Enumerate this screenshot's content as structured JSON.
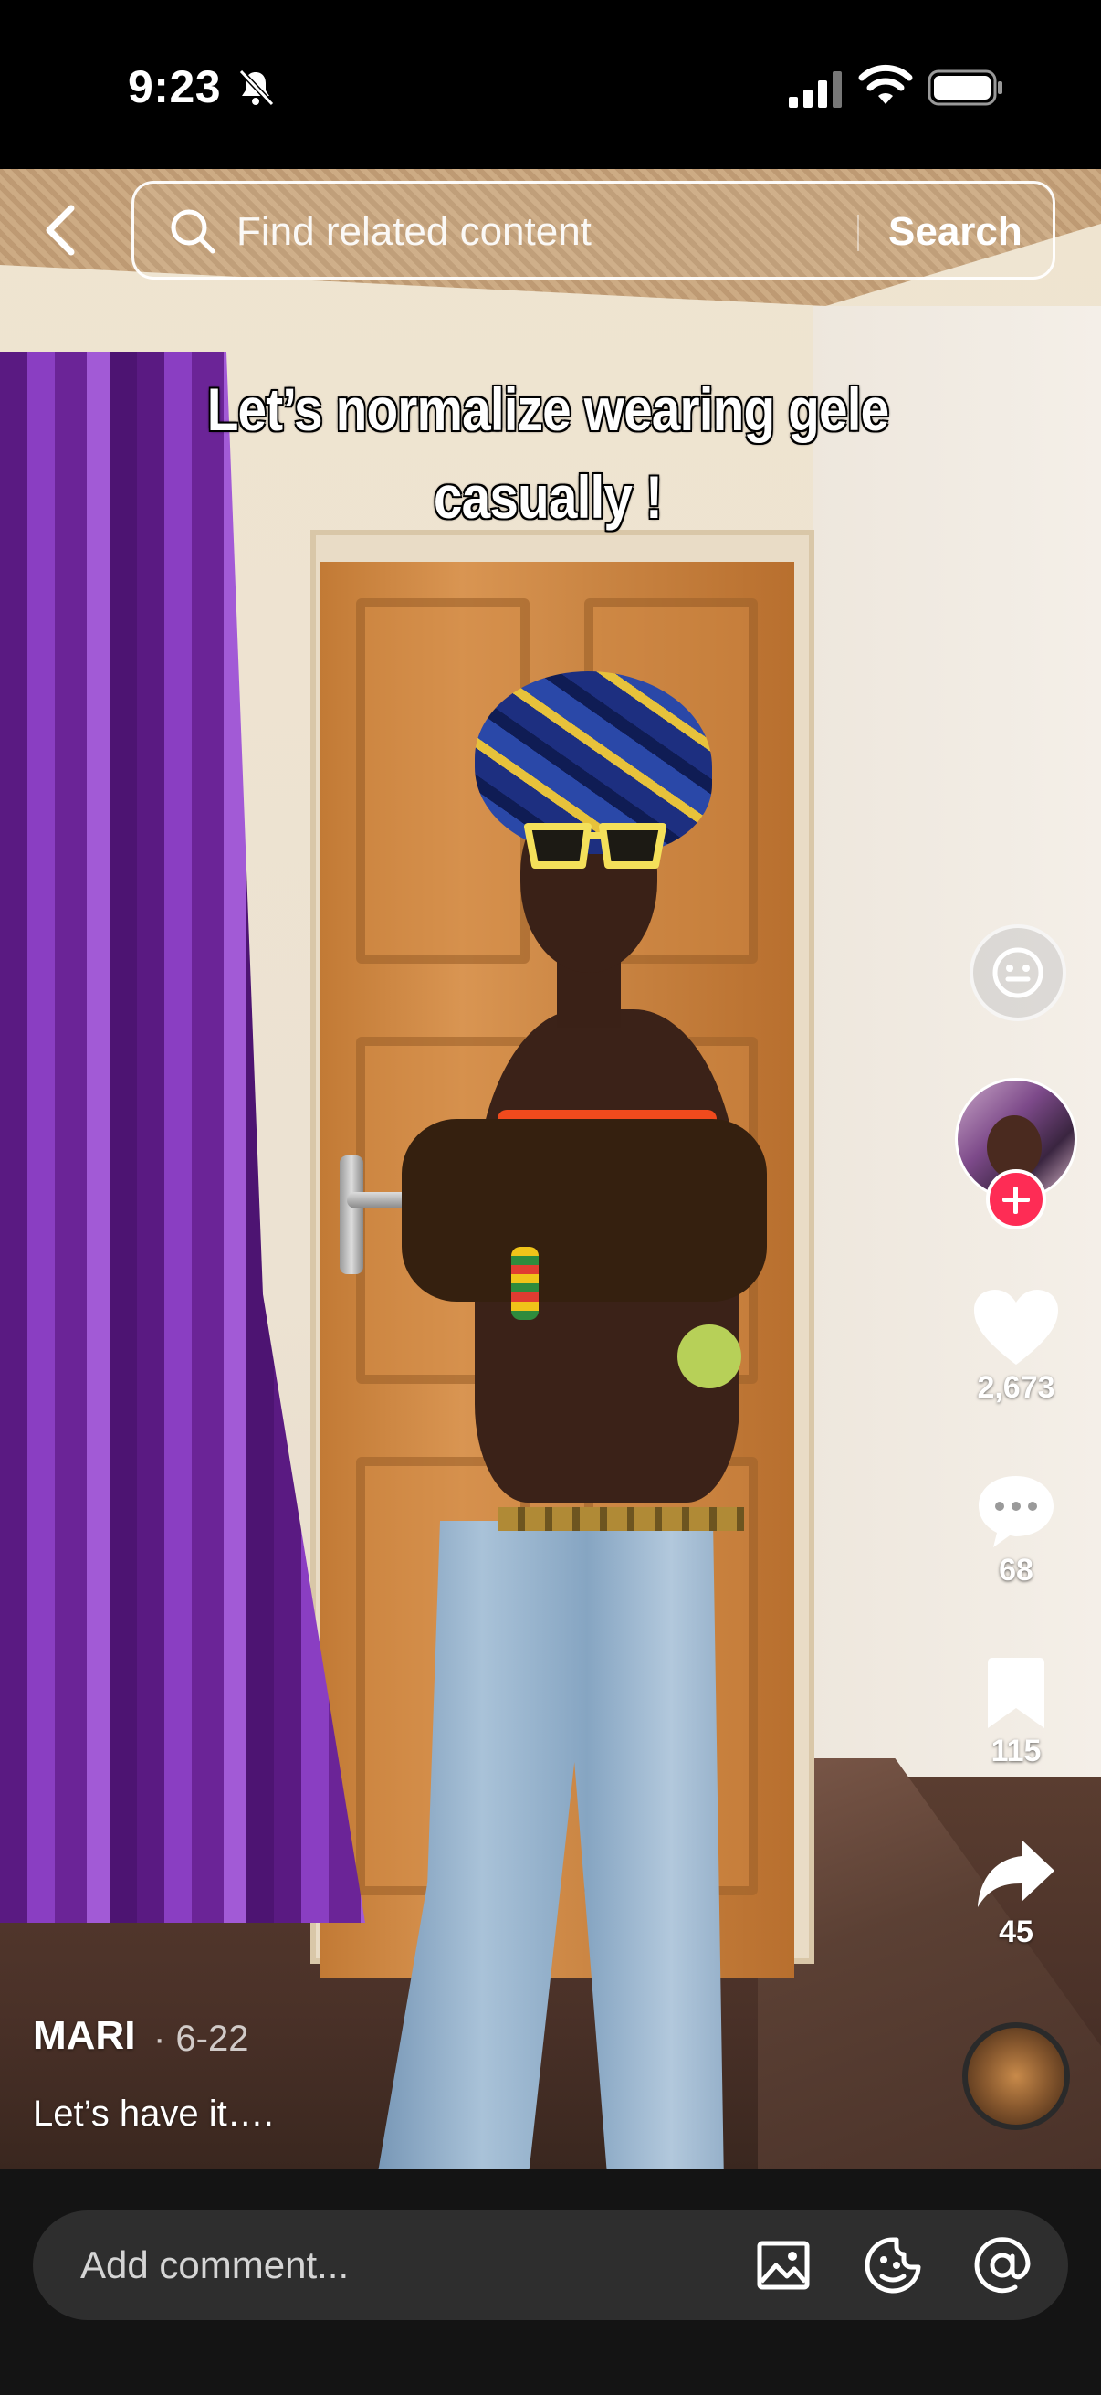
{
  "status_bar": {
    "time": "9:23"
  },
  "top_bar": {
    "search_placeholder": "Find related content",
    "search_button": "Search"
  },
  "video": {
    "overlay_caption": "Let’s normalize wearing gele casually !"
  },
  "actions": {
    "likes": "2,673",
    "comments": "68",
    "saves": "115",
    "shares": "45"
  },
  "post": {
    "author": "MARI",
    "date": "· 6-22",
    "description": "Let’s have it…."
  },
  "comment_bar": {
    "placeholder": "Add comment..."
  },
  "colors": {
    "follow_accent": "#fe2c55",
    "bottom_bar": "#141414",
    "comment_box": "#2e2e2e"
  },
  "icons": [
    "bell-slash-icon",
    "signal-icon",
    "wifi-icon",
    "battery-icon",
    "back-icon",
    "search-icon",
    "face-icon",
    "heart-icon",
    "comment-icon",
    "bookmark-icon",
    "share-icon",
    "image-icon",
    "emoji-icon",
    "mention-icon"
  ]
}
